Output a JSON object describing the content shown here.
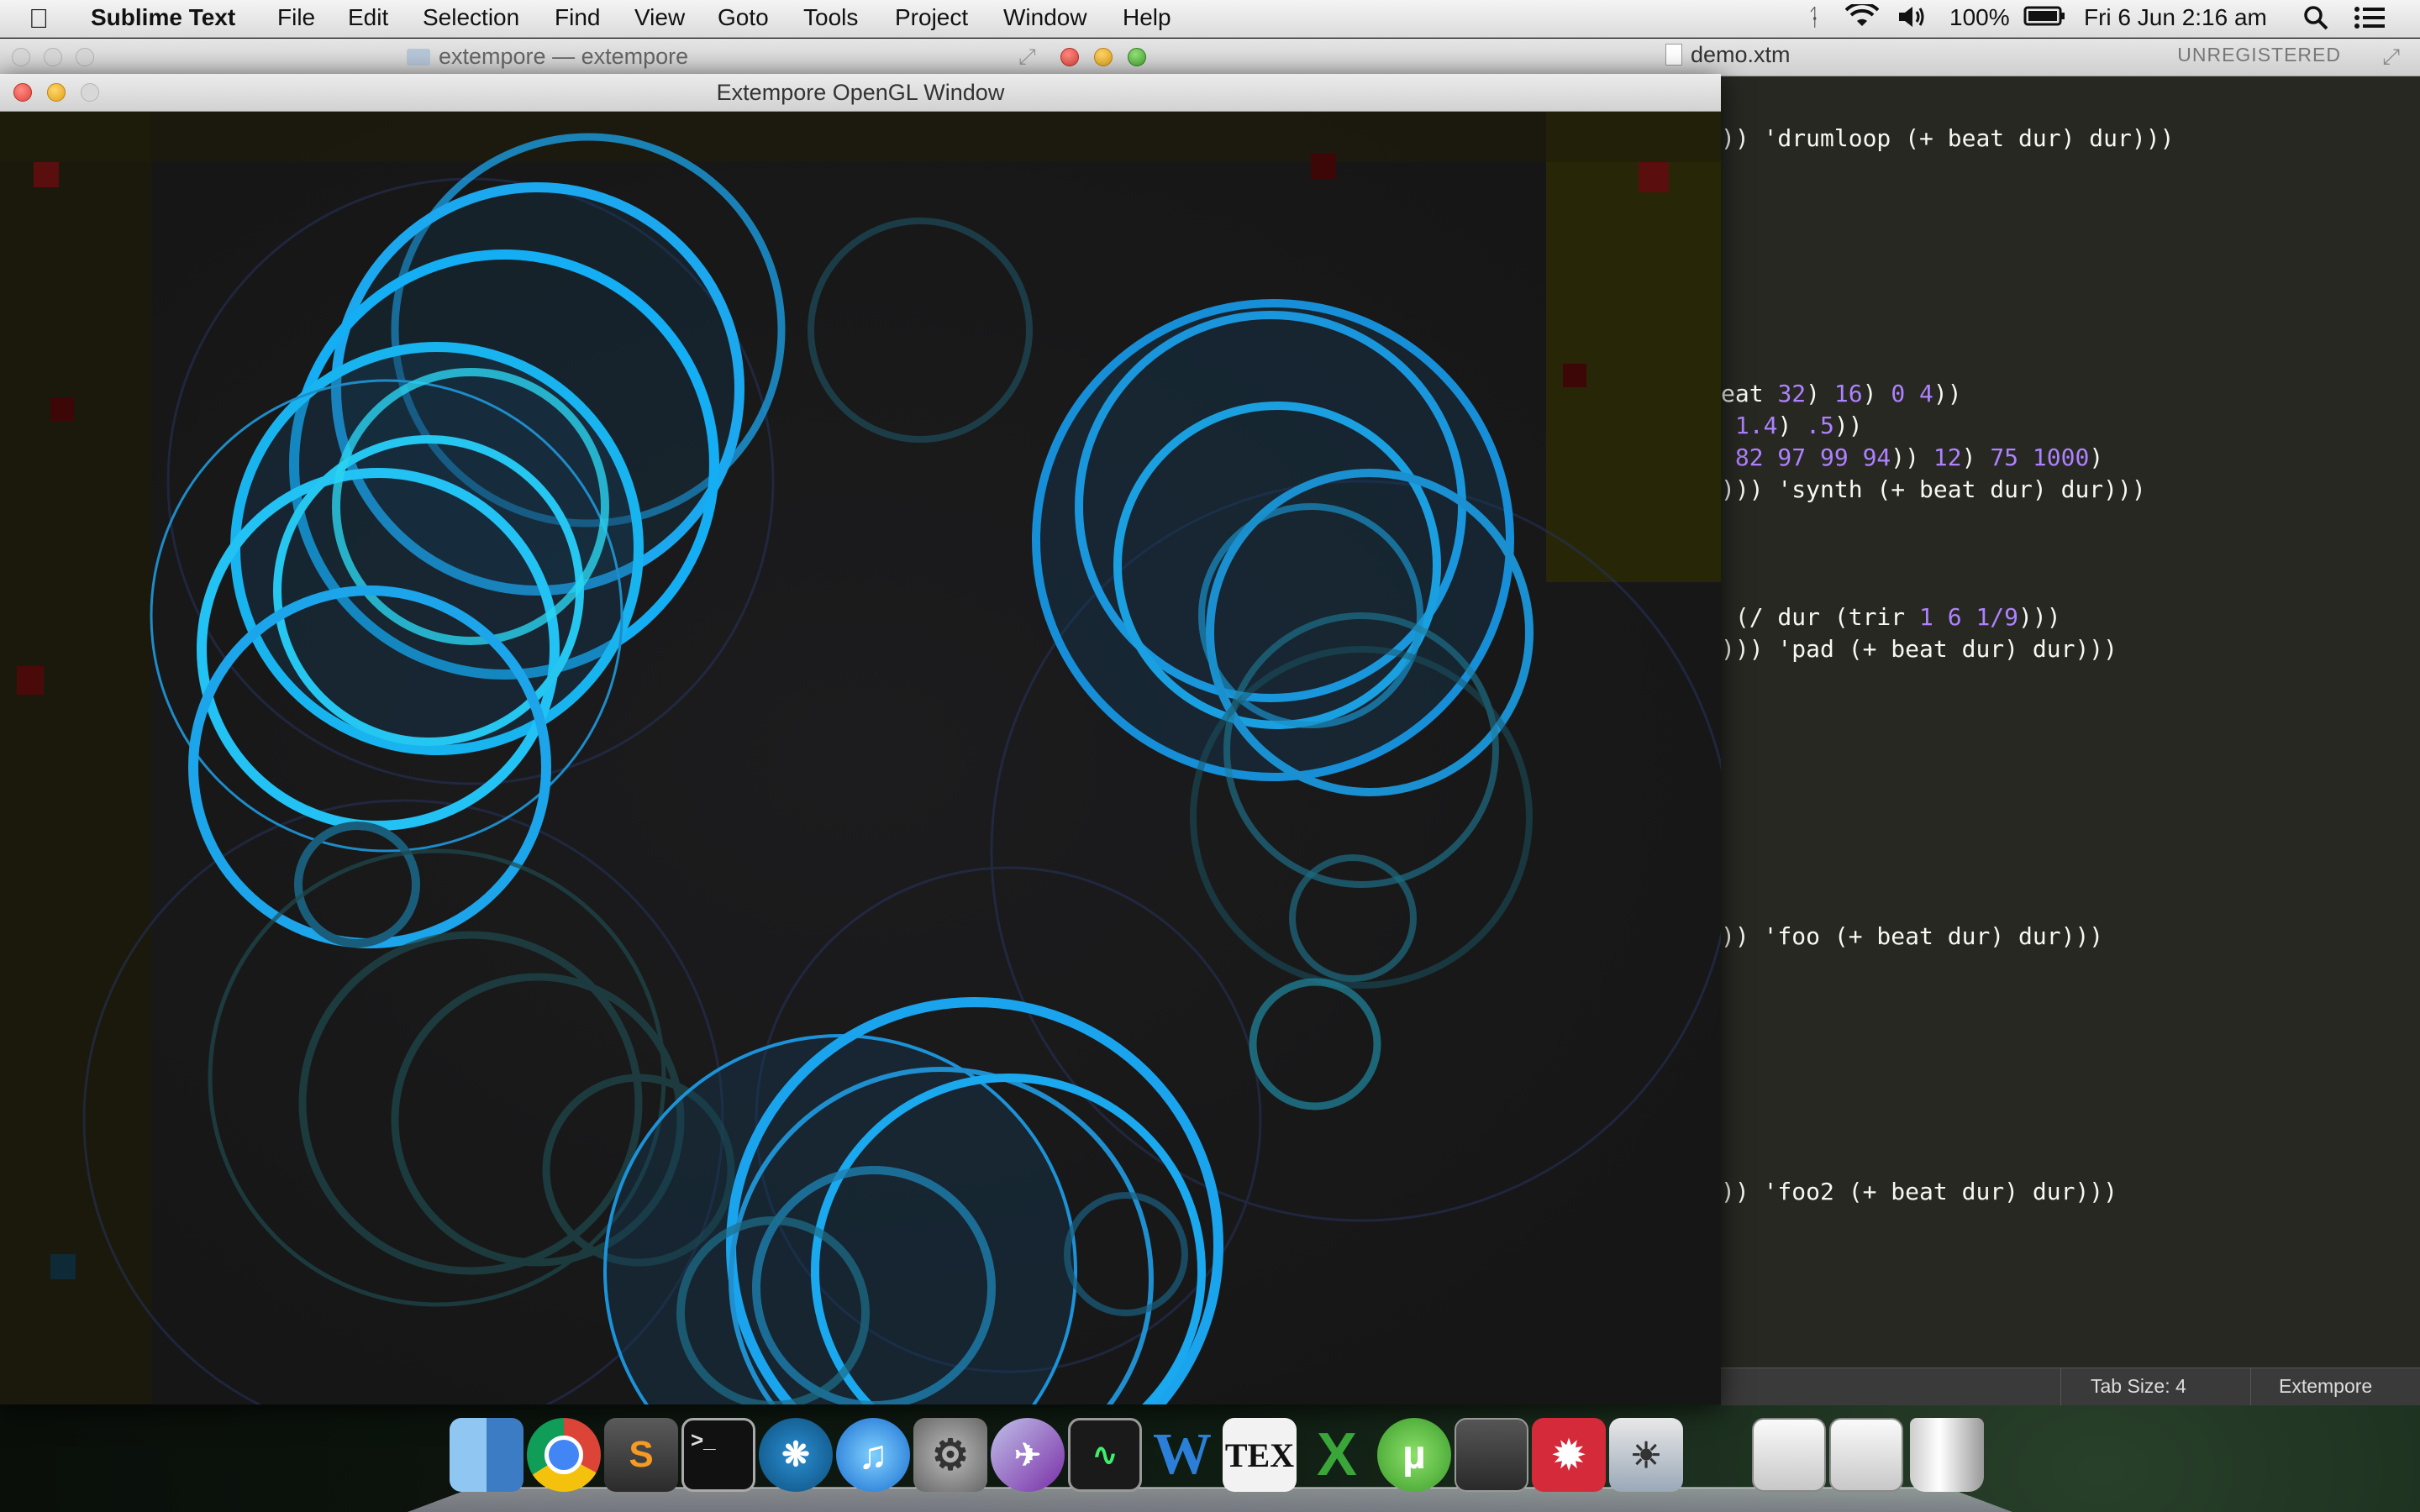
{
  "menubar": {
    "app_name": "Sublime Text",
    "menus": [
      "File",
      "Edit",
      "Selection",
      "Find",
      "View",
      "Goto",
      "Tools",
      "Project",
      "Window",
      "Help"
    ],
    "battery": "100%",
    "clock": "Fri 6 Jun  2:16 am"
  },
  "sublime": {
    "project_title": "extempore — extempore",
    "file_title": "demo.xtm",
    "unregistered": "UNREGISTERED",
    "code_lines": [
      [
        {
          "t": "))"
        },
        {
          "t": " 'drumloop (+ beat dur) dur)))"
        }
      ],
      [
        {
          "t": "eat "
        },
        {
          "t": "32",
          "n": true
        },
        {
          "t": ") "
        },
        {
          "t": "16",
          "n": true
        },
        {
          "t": ") "
        },
        {
          "t": "0",
          "n": true
        },
        {
          "t": " "
        },
        {
          "t": "4",
          "n": true
        },
        {
          "t": "))"
        }
      ],
      [
        {
          "t": " "
        },
        {
          "t": "1.4",
          "n": true
        },
        {
          "t": ") "
        },
        {
          "t": ".5",
          "n": true
        },
        {
          "t": "))"
        }
      ],
      [
        {
          "t": " "
        },
        {
          "t": "82 97 99 94",
          "n": true
        },
        {
          "t": ")) "
        },
        {
          "t": "12",
          "n": true
        },
        {
          "t": ") "
        },
        {
          "t": "75",
          "n": true
        },
        {
          "t": " "
        },
        {
          "t": "1000",
          "n": true
        },
        {
          "t": ")"
        }
      ],
      [
        {
          "t": ")))"
        },
        {
          "t": " 'synth (+ beat dur) dur)))"
        }
      ],
      [
        {
          "t": " (/ dur (trir "
        },
        {
          "t": "1",
          "n": true
        },
        {
          "t": " "
        },
        {
          "t": "6",
          "n": true
        },
        {
          "t": " "
        },
        {
          "t": "1/9",
          "n": true
        },
        {
          "t": ")))"
        }
      ],
      [
        {
          "t": ")))"
        },
        {
          "t": " 'pad (+ beat dur) dur)))"
        }
      ],
      [
        {
          "t": "))"
        },
        {
          "t": " 'foo (+ beat dur) dur)))"
        }
      ],
      [
        {
          "t": "))"
        },
        {
          "t": " 'foo2 (+ beat dur) dur)))"
        }
      ]
    ],
    "status_tab_size": "Tab Size: 4",
    "status_syntax": "Extempore"
  },
  "gl_window": {
    "title": "Extempore OpenGL Window"
  },
  "dock": {
    "items": [
      "Finder",
      "Chrome",
      "Sublime Text",
      "Terminal",
      "Extempore",
      "iTunes",
      "System Preferences",
      "Launchpad",
      "Activity Monitor",
      "Word",
      "TeXShop",
      "Excel",
      "uTorrent",
      "Console",
      "Mendeley",
      "Preview",
      "Stack",
      "Stack",
      "Trash"
    ]
  }
}
